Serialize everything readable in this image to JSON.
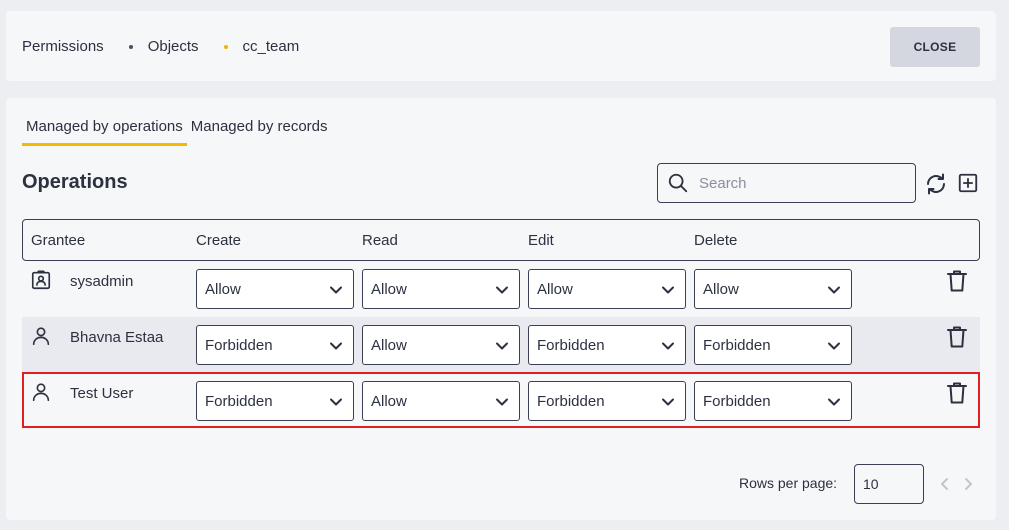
{
  "breadcrumb": [
    "Permissions",
    "Objects",
    "cc_team"
  ],
  "close_label": "CLOSE",
  "tabs": [
    {
      "label": "Managed by operations",
      "active": true
    },
    {
      "label": "Managed by records",
      "active": false
    }
  ],
  "section_title": "Operations",
  "search": {
    "placeholder": "Search",
    "value": ""
  },
  "columns": [
    "Grantee",
    "Create",
    "Read",
    "Edit",
    "Delete"
  ],
  "rows": [
    {
      "grantee": "sysadmin",
      "icon": "admin-badge-icon",
      "create": "Allow",
      "read": "Allow",
      "edit": "Allow",
      "delete": "Allow"
    },
    {
      "grantee": "Bhavna Estaa",
      "icon": "user-icon",
      "create": "Forbidden",
      "read": "Allow",
      "edit": "Forbidden",
      "delete": "Forbidden"
    },
    {
      "grantee": "Test User",
      "icon": "user-icon",
      "create": "Forbidden",
      "read": "Allow",
      "edit": "Forbidden",
      "delete": "Forbidden"
    }
  ],
  "pagination": {
    "rows_per_page_label": "Rows per page:",
    "rows_per_page": "10"
  },
  "colors": {
    "accent": "#f5b800",
    "selected_outline": "#e02020",
    "close_button_bg": "#d4d7df"
  }
}
